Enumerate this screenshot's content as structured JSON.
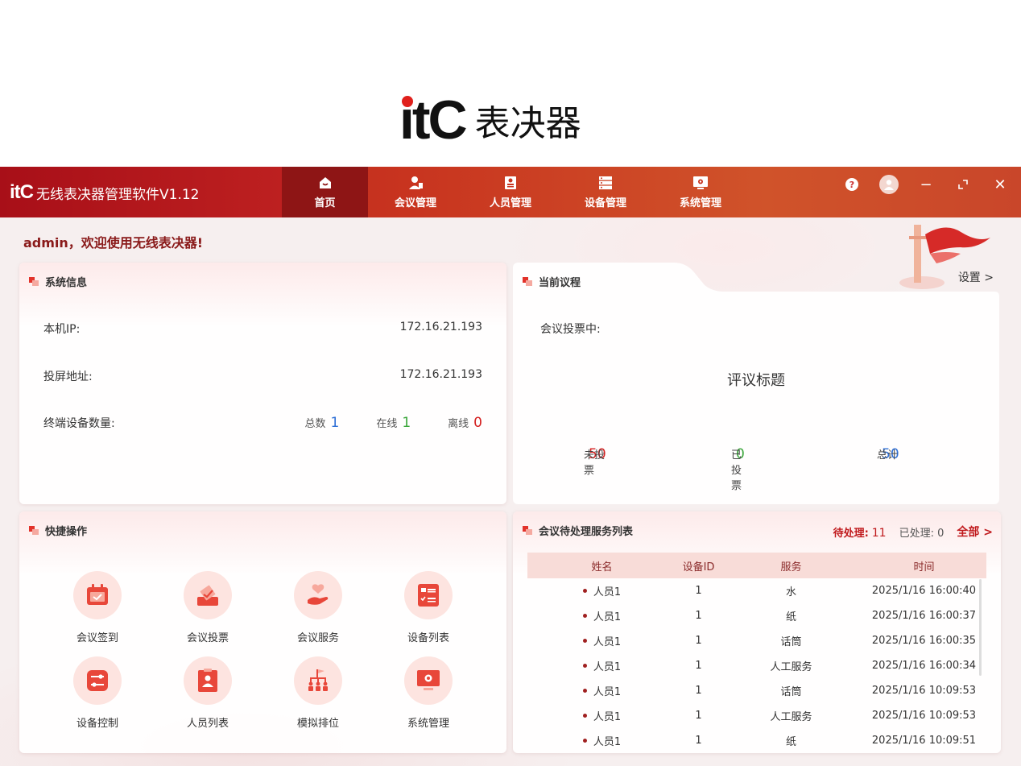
{
  "brand": {
    "logo_text": "itC",
    "product": "表决器"
  },
  "app": {
    "logo": "itC",
    "title": "无线表决器管理软件V1.12"
  },
  "nav": [
    {
      "label": "首页",
      "icon": "home-icon",
      "active": true
    },
    {
      "label": "会议管理",
      "icon": "meeting-icon"
    },
    {
      "label": "人员管理",
      "icon": "personnel-icon"
    },
    {
      "label": "设备管理",
      "icon": "device-icon"
    },
    {
      "label": "系统管理",
      "icon": "system-icon"
    }
  ],
  "window": {
    "help": "?",
    "minimize": "−",
    "restore": "⤢",
    "close": "✕"
  },
  "welcome": "admin，欢迎使用无线表决器!",
  "system_info": {
    "title": "系统信息",
    "ip_label": "本机IP:",
    "ip_value": "172.16.21.193",
    "cast_label": "投屏地址:",
    "cast_value": "172.16.21.193",
    "terminal_label": "终端设备数量:",
    "total_label": "总数",
    "total_value": "1",
    "online_label": "在线",
    "online_value": "1",
    "offline_label": "离线",
    "offline_value": "0"
  },
  "agenda": {
    "title": "当前议程",
    "settings": "设置 >",
    "status": "会议投票中:",
    "vote_title": "评议标题",
    "not_voted_label": "未投票",
    "not_voted_value": "50",
    "voted_label": "已投票",
    "voted_value": "0",
    "total_label": "总计",
    "total_value": "50"
  },
  "quick_ops": {
    "title": "快捷操作",
    "items": [
      {
        "label": "会议签到",
        "icon": "sign-in-icon"
      },
      {
        "label": "会议投票",
        "icon": "vote-icon"
      },
      {
        "label": "会议服务",
        "icon": "service-icon"
      },
      {
        "label": "设备列表",
        "icon": "device-list-icon"
      },
      {
        "label": "设备控制",
        "icon": "device-control-icon"
      },
      {
        "label": "人员列表",
        "icon": "personnel-list-icon"
      },
      {
        "label": "模拟排位",
        "icon": "seating-icon"
      },
      {
        "label": "系统管理",
        "icon": "system-manage-icon"
      }
    ]
  },
  "service_list": {
    "title": "会议待处理服务列表",
    "pending_label": "待处理:",
    "pending_value": "11",
    "done_label": "已处理: 0",
    "all_link": "全部 >",
    "columns": [
      "姓名",
      "设备ID",
      "服务",
      "时间"
    ],
    "rows": [
      [
        "人员1",
        "1",
        "水",
        "2025/1/16 16:00:40"
      ],
      [
        "人员1",
        "1",
        "纸",
        "2025/1/16 16:00:37"
      ],
      [
        "人员1",
        "1",
        "话筒",
        "2025/1/16 16:00:35"
      ],
      [
        "人员1",
        "1",
        "人工服务",
        "2025/1/16 16:00:34"
      ],
      [
        "人员1",
        "1",
        "话筒",
        "2025/1/16 10:09:53"
      ],
      [
        "人员1",
        "1",
        "人工服务",
        "2025/1/16 10:09:53"
      ],
      [
        "人员1",
        "1",
        "纸",
        "2025/1/16 10:09:51"
      ]
    ]
  },
  "colors": {
    "accent": "#c0191c",
    "blue": "#2e6fd6",
    "green": "#3aa63a",
    "red": "#d42020"
  }
}
